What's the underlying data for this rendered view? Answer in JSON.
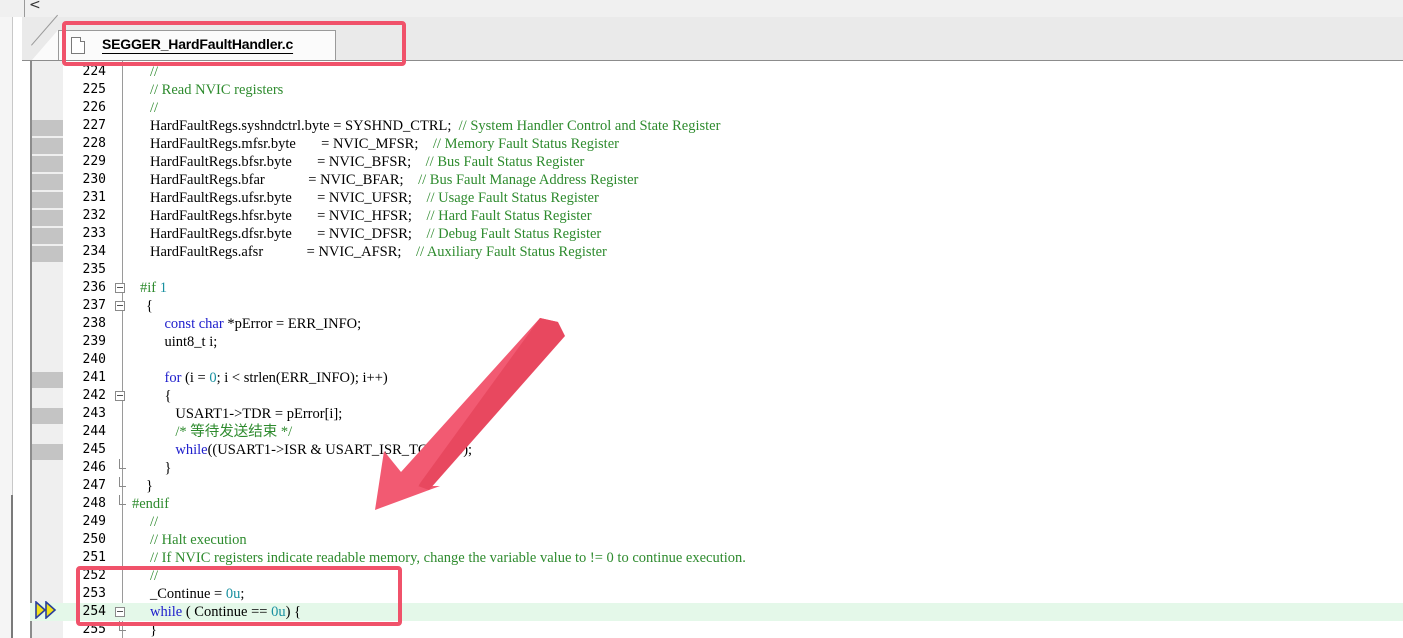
{
  "toolbar": {
    "scroll_left_glyph": "<"
  },
  "tab": {
    "label": "SEGGER_HardFaultHandler.c",
    "icon": "file-icon"
  },
  "editor": {
    "execution_line": 254,
    "lines": [
      {
        "n": 224,
        "segs": [
          {
            "t": "//",
            "c": "comment"
          }
        ]
      },
      {
        "n": 225,
        "segs": [
          {
            "t": "// Read NVIC registers",
            "c": "comment"
          }
        ]
      },
      {
        "n": 226,
        "segs": [
          {
            "t": "//",
            "c": "comment"
          }
        ]
      },
      {
        "n": 227,
        "bp": true,
        "segs": [
          {
            "t": "HardFaultRegs.syshndctrl.byte = SYSHND_CTRL;  "
          },
          {
            "t": "// System Handler Control and State Register",
            "c": "comment"
          }
        ]
      },
      {
        "n": 228,
        "bp": true,
        "segs": [
          {
            "t": "HardFaultRegs.mfsr.byte       = NVIC_MFSR;    "
          },
          {
            "t": "// Memory Fault Status Register",
            "c": "comment"
          }
        ]
      },
      {
        "n": 229,
        "bp": true,
        "segs": [
          {
            "t": "HardFaultRegs.bfsr.byte       = NVIC_BFSR;    "
          },
          {
            "t": "// Bus Fault Status Register",
            "c": "comment"
          }
        ]
      },
      {
        "n": 230,
        "bp": true,
        "segs": [
          {
            "t": "HardFaultRegs.bfar            = NVIC_BFAR;    "
          },
          {
            "t": "// Bus Fault Manage Address Register",
            "c": "comment"
          }
        ]
      },
      {
        "n": 231,
        "bp": true,
        "segs": [
          {
            "t": "HardFaultRegs.ufsr.byte       = NVIC_UFSR;    "
          },
          {
            "t": "// Usage Fault Status Register",
            "c": "comment"
          }
        ]
      },
      {
        "n": 232,
        "bp": true,
        "segs": [
          {
            "t": "HardFaultRegs.hfsr.byte       = NVIC_HFSR;    "
          },
          {
            "t": "// Hard Fault Status Register",
            "c": "comment"
          }
        ]
      },
      {
        "n": 233,
        "bp": true,
        "segs": [
          {
            "t": "HardFaultRegs.dfsr.byte       = NVIC_DFSR;    "
          },
          {
            "t": "// Debug Fault Status Register",
            "c": "comment"
          }
        ]
      },
      {
        "n": 234,
        "bp": true,
        "segs": [
          {
            "t": "HardFaultRegs.afsr            = NVIC_AFSR;    "
          },
          {
            "t": "// Auxiliary Fault Status Register",
            "c": "comment"
          }
        ]
      },
      {
        "n": 235,
        "segs": []
      },
      {
        "n": 236,
        "fold": "open",
        "segs": [
          {
            "t": "#if ",
            "c": "pp"
          },
          {
            "t": "1",
            "c": "num"
          }
        ],
        "indent": -10
      },
      {
        "n": 237,
        "fold": "open",
        "segs": [
          {
            "t": "{"
          }
        ],
        "indent": -4
      },
      {
        "n": 238,
        "segs": [
          {
            "t": "    "
          },
          {
            "t": "const char",
            "c": "kw"
          },
          {
            "t": " *pError = ERR_INFO;"
          }
        ]
      },
      {
        "n": 239,
        "segs": [
          {
            "t": "    uint8_t i;"
          }
        ]
      },
      {
        "n": 240,
        "segs": []
      },
      {
        "n": 241,
        "bp": true,
        "segs": [
          {
            "t": "    "
          },
          {
            "t": "for",
            "c": "kw"
          },
          {
            "t": " (i = "
          },
          {
            "t": "0",
            "c": "num"
          },
          {
            "t": "; i < strlen(ERR_INFO); i++)"
          }
        ]
      },
      {
        "n": 242,
        "fold": "open",
        "segs": [
          {
            "t": "    {"
          }
        ]
      },
      {
        "n": 243,
        "bp": true,
        "segs": [
          {
            "t": "       USART1->TDR = pError[i];"
          }
        ]
      },
      {
        "n": 244,
        "segs": [
          {
            "t": "       "
          },
          {
            "t": "/* 等待发送结束 */",
            "c": "comment"
          }
        ]
      },
      {
        "n": 245,
        "bp": true,
        "segs": [
          {
            "t": "       "
          },
          {
            "t": "while",
            "c": "kw"
          },
          {
            "t": "((USART1->ISR & USART_ISR_TC) == "
          },
          {
            "t": "0",
            "c": "num"
          },
          {
            "t": ");"
          }
        ]
      },
      {
        "n": 246,
        "fold": "end",
        "segs": [
          {
            "t": "    }"
          }
        ]
      },
      {
        "n": 247,
        "fold": "end",
        "segs": [
          {
            "t": "}"
          }
        ],
        "indent": -4
      },
      {
        "n": 248,
        "fold": "endleft",
        "segs": [
          {
            "t": "#endif",
            "c": "pp"
          }
        ],
        "indent": -18
      },
      {
        "n": 249,
        "segs": [
          {
            "t": "//",
            "c": "comment"
          }
        ]
      },
      {
        "n": 250,
        "segs": [
          {
            "t": "// Halt execution",
            "c": "comment"
          }
        ]
      },
      {
        "n": 251,
        "segs": [
          {
            "t": "// If NVIC registers indicate readable memory, change the variable value to != 0 to continue execution.",
            "c": "comment"
          }
        ]
      },
      {
        "n": 252,
        "segs": [
          {
            "t": "//",
            "c": "comment"
          }
        ]
      },
      {
        "n": 253,
        "segs": [
          {
            "t": "_Continue = "
          },
          {
            "t": "0u",
            "c": "num"
          },
          {
            "t": ";"
          }
        ]
      },
      {
        "n": 254,
        "fold": "open",
        "current": true,
        "segs": [
          {
            "t": "while",
            "c": "kw"
          },
          {
            "t": " ( Continue == "
          },
          {
            "t": "0u",
            "c": "num"
          },
          {
            "t": ") {"
          }
        ]
      },
      {
        "n": 255,
        "fold": "end",
        "segs": [
          {
            "t": "}"
          }
        ]
      }
    ]
  },
  "colors": {
    "highlight_box": "#f0526a",
    "current_line": "#e4f8e9",
    "comment": "#2e8b2e",
    "keyword": "#1d1dcc",
    "number": "#1890a0"
  }
}
